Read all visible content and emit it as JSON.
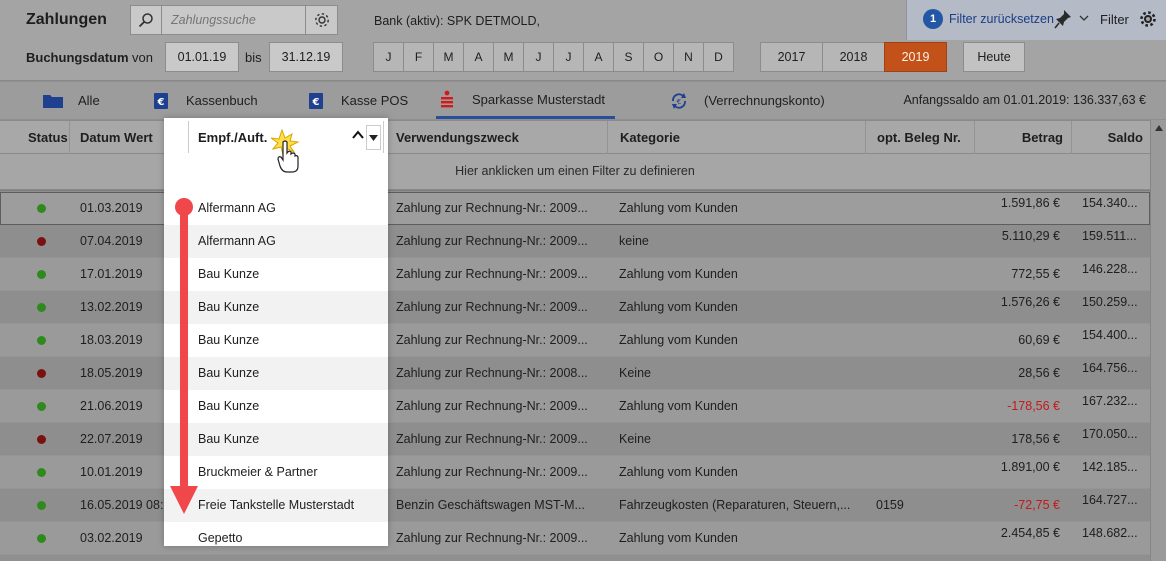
{
  "header": {
    "title": "Zahlungen",
    "search_placeholder": "Zahlungssuche",
    "bank_label": "Bank (aktiv): SPK DETMOLD,",
    "filter_badge": "1",
    "filter_reset": "Filter zurücksetzen",
    "filter_label": "Filter"
  },
  "date_filter": {
    "label": "Buchungsdatum",
    "from_label": "von",
    "from": "01.01.19",
    "to_label": "bis",
    "to": "31.12.19",
    "months": [
      "J",
      "F",
      "M",
      "A",
      "M",
      "J",
      "J",
      "A",
      "S",
      "O",
      "N",
      "D"
    ],
    "years": [
      "2017",
      "2018",
      "2019"
    ],
    "active_year": "2019",
    "today_label": "Heute"
  },
  "tabs": [
    {
      "label": "Alle",
      "icon": "folder-icon"
    },
    {
      "label": "Kassenbuch",
      "icon": "cash-book-icon"
    },
    {
      "label": "Kasse POS",
      "icon": "cash-pos-icon"
    },
    {
      "label": "Sparkasse Musterstadt",
      "icon": "sparkasse-icon",
      "active": true
    },
    {
      "label": "(Verrechnungskonto)",
      "icon": "clearing-account-icon"
    }
  ],
  "opening_balance": "Anfangssaldo am 01.01.2019: 136.337,63 €",
  "columns": {
    "status": "Status",
    "date": "Datum Wert",
    "recipient": "Empf./Auft.",
    "purpose": "Verwendungszweck",
    "category": "Kategorie",
    "receipt": "opt. Beleg Nr.",
    "amount": "Betrag",
    "balance": "Saldo"
  },
  "filter_hint": "Hier anklicken um einen Filter zu definieren",
  "rows": [
    {
      "status": "green",
      "date": "01.03.2019",
      "recipient": "Alfermann AG",
      "purpose": "Zahlung zur Rechnung-Nr.: 2009...",
      "category": "Zahlung vom Kunden",
      "receipt": "",
      "amount": "1.591,86 €",
      "balance": "154.340...",
      "negative": false
    },
    {
      "status": "red",
      "date": "07.04.2019",
      "recipient": "Alfermann AG",
      "purpose": "Zahlung zur Rechnung-Nr.: 2009...",
      "category": "keine",
      "receipt": "",
      "amount": "5.110,29 €",
      "balance": "159.511...",
      "negative": false
    },
    {
      "status": "green",
      "date": "17.01.2019",
      "recipient": "Bau Kunze",
      "purpose": "Zahlung zur Rechnung-Nr.: 2009...",
      "category": "Zahlung vom Kunden",
      "receipt": "",
      "amount": "772,55 €",
      "balance": "146.228...",
      "negative": false
    },
    {
      "status": "green",
      "date": "13.02.2019",
      "recipient": "Bau Kunze",
      "purpose": "Zahlung zur Rechnung-Nr.: 2009...",
      "category": "Zahlung vom Kunden",
      "receipt": "",
      "amount": "1.576,26 €",
      "balance": "150.259...",
      "negative": false
    },
    {
      "status": "green",
      "date": "18.03.2019",
      "recipient": "Bau Kunze",
      "purpose": "Zahlung zur Rechnung-Nr.: 2009...",
      "category": "Zahlung vom Kunden",
      "receipt": "",
      "amount": "60,69 €",
      "balance": "154.400...",
      "negative": false
    },
    {
      "status": "red",
      "date": "18.05.2019",
      "recipient": "Bau Kunze",
      "purpose": "Zahlung zur Rechnung-Nr.: 2008...",
      "category": "Keine",
      "receipt": "",
      "amount": "28,56 €",
      "balance": "164.756...",
      "negative": false
    },
    {
      "status": "green",
      "date": "21.06.2019",
      "recipient": "Bau Kunze",
      "purpose": "Zahlung zur Rechnung-Nr.: 2009...",
      "category": "Zahlung vom Kunden",
      "receipt": "",
      "amount": "-178,56 €",
      "balance": "167.232...",
      "negative": true
    },
    {
      "status": "red",
      "date": "22.07.2019",
      "recipient": "Bau Kunze",
      "purpose": "Zahlung zur Rechnung-Nr.: 2009...",
      "category": "Keine",
      "receipt": "",
      "amount": "178,56 €",
      "balance": "170.050...",
      "negative": false
    },
    {
      "status": "green",
      "date": "10.01.2019",
      "recipient": "Bruckmeier & Partner",
      "purpose": "Zahlung zur Rechnung-Nr.: 2009...",
      "category": "Zahlung vom Kunden",
      "receipt": "",
      "amount": "1.891,00 €",
      "balance": "142.185...",
      "negative": false
    },
    {
      "status": "green",
      "date": "16.05.2019 08:...",
      "recipient": "Freie Tankstelle Musterstadt",
      "purpose": "Benzin Geschäftswagen MST-M...",
      "category": "Fahrzeugkosten (Reparaturen, Steuern,...",
      "receipt": "0159",
      "amount": "-72,75 €",
      "balance": "164.727...",
      "negative": true
    },
    {
      "status": "green",
      "date": "03.02.2019",
      "recipient": "Gepetto",
      "purpose": "Zahlung zur Rechnung-Nr.: 2009...",
      "category": "Zahlung vom Kunden",
      "receipt": "",
      "amount": "2.454,85 €",
      "balance": "148.682...",
      "negative": false
    }
  ],
  "colors": {
    "accent": "#2456a6",
    "active_year": "#c2511a",
    "negative": "#c41a1a",
    "status_ok": "#2f8a1e",
    "status_open": "#7a1111",
    "arrow": "#f0474b"
  }
}
